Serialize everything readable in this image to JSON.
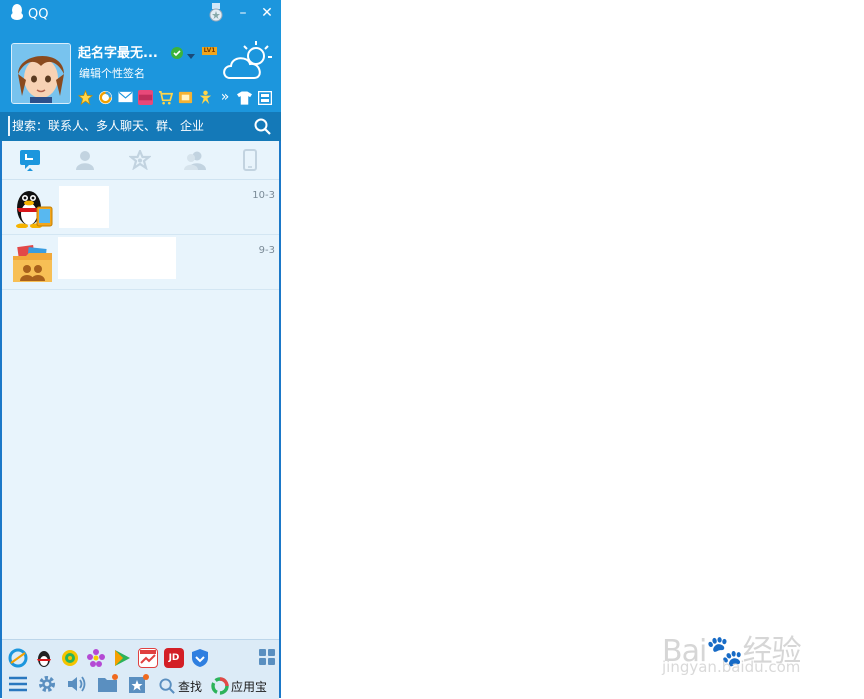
{
  "window": {
    "title": "QQ",
    "minimize_label": "–",
    "close_label": "✕"
  },
  "profile": {
    "nickname": "起名字最无...",
    "level_badge": "LV1",
    "signature": "编辑个性签名",
    "more_label": "»"
  },
  "search": {
    "placeholder": "搜索：联系人、多人聊天、群、企业"
  },
  "tabs": [
    {
      "name": "tab-messages",
      "icon": "chat-bubble-icon",
      "active": true
    },
    {
      "name": "tab-contacts",
      "icon": "person-icon",
      "active": false
    },
    {
      "name": "tab-favorites",
      "icon": "star-icon",
      "active": false
    },
    {
      "name": "tab-groups",
      "icon": "group-icon",
      "active": false
    },
    {
      "name": "tab-devices",
      "icon": "phone-icon",
      "active": false
    }
  ],
  "conversations": [
    {
      "icon": "qq-penguin-device-icon",
      "date": "10-3"
    },
    {
      "icon": "shared-folder-icon",
      "date": "9-3"
    }
  ],
  "bottom_apps": {
    "jd_label": "JD"
  },
  "bottom_tools": {
    "find_label": "查找",
    "app_store_label": "应用宝"
  },
  "watermark": {
    "brand": "Bai🐾经验",
    "url": "jingyan.baidu.com"
  },
  "colors": {
    "header_blue": "#1c96dd",
    "search_blue": "#1479b8",
    "list_bg": "#e8f4fc",
    "accent": "#1c96dd"
  }
}
